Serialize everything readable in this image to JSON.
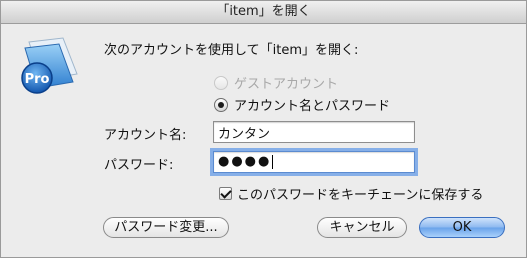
{
  "window": {
    "title": "「item」を開く"
  },
  "dialog": {
    "prompt": "次のアカウントを使用して「item」を開く:",
    "app_icon": "filemaker-pro-icon",
    "app_icon_text": "Pro"
  },
  "account_type": {
    "guest_label": "ゲストアカウント",
    "guest_enabled": false,
    "named_label": "アカウント名とパスワード",
    "selected": "named"
  },
  "account_name": {
    "label": "アカウント名:",
    "value": "カンタン"
  },
  "password": {
    "label": "パスワード:",
    "masked_value": "●●●●"
  },
  "keychain": {
    "label": "このパスワードをキーチェーンに保存する",
    "checked": true
  },
  "buttons": {
    "change_password": "パスワード変更...",
    "cancel": "キャンセル",
    "ok": "OK"
  },
  "colors": {
    "default_button": "#6aa3ea",
    "focus_ring": "#86afe8",
    "window_bg": "#ececec"
  }
}
